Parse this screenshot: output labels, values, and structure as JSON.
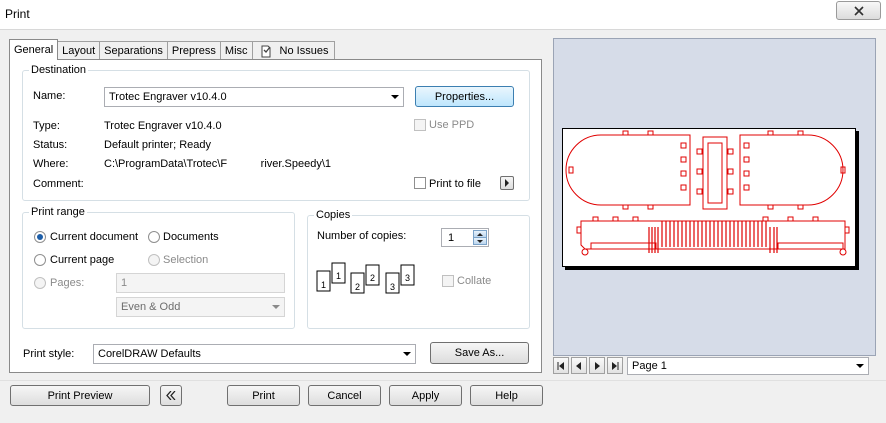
{
  "window": {
    "title": "Print"
  },
  "tabs": [
    {
      "label": "General",
      "active": true
    },
    {
      "label": "Layout"
    },
    {
      "label": "Separations"
    },
    {
      "label": "Prepress"
    },
    {
      "label": "Misc"
    },
    {
      "label": "No Issues",
      "icon": "issues-icon"
    }
  ],
  "destination": {
    "group_label": "Destination",
    "name_label": "Name:",
    "name_value": "Trotec Engraver v10.4.0",
    "properties_button": "Properties...",
    "type_label": "Type:",
    "type_value": "Trotec Engraver v10.4.0",
    "status_label": "Status:",
    "status_value": "Default printer; Ready",
    "where_label": "Where:",
    "where_value": "C:\\ProgramData\\Trotec\\F           river.Speedy\\1",
    "comment_label": "Comment:",
    "use_ppd_label": "Use PPD",
    "print_to_file_label": "Print to file"
  },
  "print_range": {
    "group_label": "Print range",
    "current_document": "Current document",
    "documents": "Documents",
    "current_page": "Current page",
    "selection": "Selection",
    "pages_label": "Pages:",
    "pages_value": "1",
    "page_set_value": "Even & Odd",
    "selected": "current_document"
  },
  "copies": {
    "group_label": "Copies",
    "number_label": "Number of copies:",
    "number_value": "1",
    "collate_label": "Collate",
    "illustration_digits": [
      "1",
      "1",
      "2",
      "2",
      "3",
      "3"
    ]
  },
  "print_style": {
    "label": "Print style:",
    "value": "CorelDRAW Defaults",
    "save_as_button": "Save As..."
  },
  "buttons": {
    "print_preview": "Print Preview",
    "print": "Print",
    "cancel": "Cancel",
    "apply": "Apply",
    "help": "Help"
  },
  "preview": {
    "page_select_value": "Page 1",
    "line_color": "#e00000"
  }
}
